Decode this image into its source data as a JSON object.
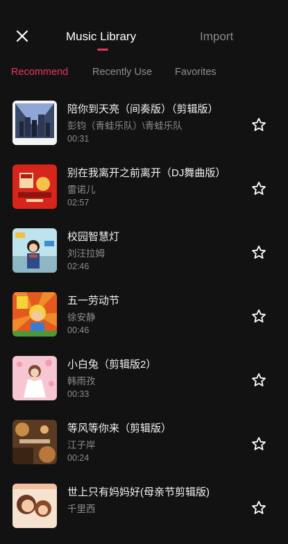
{
  "header": {
    "close_icon": "close-icon",
    "tabs": [
      {
        "label": "Music Library",
        "active": true
      },
      {
        "label": "Import",
        "active": false
      }
    ],
    "accent_color": "#e8365b"
  },
  "subtabs": [
    {
      "label": "Recommend",
      "active": true
    },
    {
      "label": "Recently Use",
      "active": false
    },
    {
      "label": "Favorites",
      "active": false
    }
  ],
  "songs": [
    {
      "title": "陪你到天亮（间奏版）（剪辑版）",
      "artist": "彭钧（青蛙乐队）\\青蛙乐队",
      "duration": "00:31"
    },
    {
      "title": "别在我离开之前离开（DJ舞曲版）",
      "artist": "雷诺儿",
      "duration": "02:57"
    },
    {
      "title": "校园智慧灯",
      "artist": "刘汪拉姆",
      "duration": "02:46"
    },
    {
      "title": "五一劳动节",
      "artist": "徐安静",
      "duration": "00:46"
    },
    {
      "title": "小白兔（剪辑版2）",
      "artist": "韩雨孜",
      "duration": "00:33"
    },
    {
      "title": "等风等你来（剪辑版）",
      "artist": "江子岸",
      "duration": "00:24"
    },
    {
      "title": "世上只有妈妈好(母亲节剪辑版)",
      "artist": "千里西",
      "duration": ""
    }
  ]
}
